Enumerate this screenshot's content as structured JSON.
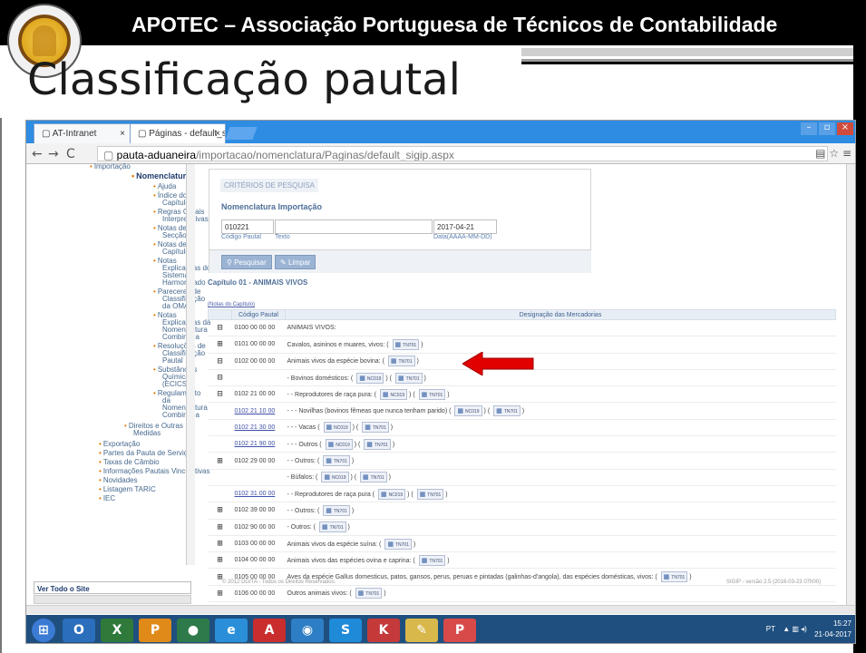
{
  "header": {
    "organization": "APOTEC – Associação Portuguesa de Técnicos de Contabilidade",
    "title": "Classificação pautal"
  },
  "browser": {
    "tabs": [
      "AT-Intranet",
      "Páginas - default_sigip"
    ],
    "url_host": "pauta-aduaneira",
    "url_path": "/importacao/nomenclatura/Paginas/default_sigip.aspx"
  },
  "sidebar": {
    "items": [
      {
        "label": "Importação",
        "bold": false
      },
      {
        "label": "Nomenclatura",
        "bold": true
      },
      {
        "label": "Ajuda",
        "bold": false
      },
      {
        "label": "Índice dos",
        "bold": false
      },
      {
        "label": "Capítulos",
        "bold": false
      },
      {
        "label": "Regras Gerais",
        "bold": false
      },
      {
        "label": "Interpretativas",
        "bold": false
      },
      {
        "label": "Notas de",
        "bold": false
      },
      {
        "label": "Secção",
        "bold": false
      },
      {
        "label": "Notas de",
        "bold": false
      },
      {
        "label": "Capítulo",
        "bold": false
      },
      {
        "label": "Notas",
        "bold": false
      },
      {
        "label": "Explicativas do",
        "bold": false
      },
      {
        "label": "Sistema",
        "bold": false
      },
      {
        "label": "Harmonizado",
        "bold": false
      },
      {
        "label": "Pareceres de",
        "bold": false
      },
      {
        "label": "Classificação",
        "bold": false
      },
      {
        "label": "da OMA",
        "bold": false
      },
      {
        "label": "Notas",
        "bold": false
      },
      {
        "label": "Explicativas da",
        "bold": false
      },
      {
        "label": "Nomenclatura",
        "bold": false
      },
      {
        "label": "Combinada",
        "bold": false
      },
      {
        "label": "Resoluções de",
        "bold": false
      },
      {
        "label": "Classificação",
        "bold": false
      },
      {
        "label": "Pautal",
        "bold": false
      },
      {
        "label": "Substâncias",
        "bold": false
      },
      {
        "label": "Químicas",
        "bold": false
      },
      {
        "label": "(ECICS)",
        "bold": false
      },
      {
        "label": "Regulamento",
        "bold": false
      },
      {
        "label": "da",
        "bold": false
      },
      {
        "label": "Nomenclatura",
        "bold": false
      },
      {
        "label": "Combinada",
        "bold": false
      },
      {
        "label": "Direitos e Outras",
        "bold": false
      },
      {
        "label": "Medidas",
        "bold": false
      },
      {
        "label": "Exportação",
        "bold": false
      },
      {
        "label": "Partes da Pauta de Serviço",
        "bold": false
      },
      {
        "label": "Taxas de Câmbio",
        "bold": false
      },
      {
        "label": "Informações Pautais Vinculativas",
        "bold": false
      },
      {
        "label": "Novidades",
        "bold": false
      },
      {
        "label": "Listagem TARIC",
        "bold": false
      },
      {
        "label": "IEC",
        "bold": false
      }
    ],
    "see_all": "Ver Todo o Site"
  },
  "search": {
    "legend": "CRITÉRIOS DE PESQUISA",
    "title": "Nomenclatura Importação",
    "code_value": "010221",
    "text_value": "",
    "date_value": "2017-04-21",
    "code_label": "Código Pautal",
    "text_label": "Texto",
    "date_label": "Data(AAAA-MM-DD)",
    "search_button": "Pesquisar",
    "clear_button": "Limpar"
  },
  "chapter": {
    "title": "Capítulo 01 - ANIMAIS VIVOS",
    "notes_link": "(Notas do Capítulo)"
  },
  "table": {
    "col_code": "Código Pautal",
    "col_desc": "Designação das Mercadorias",
    "rows": [
      {
        "sym": "⊟",
        "code": "0100 00 00 00",
        "desc": "ANIMAIS VIVOS:",
        "tags": [],
        "link": false
      },
      {
        "sym": "⊞",
        "code": "0101 00 00 00",
        "desc": "Cavalos, asininos e muares, vivos:",
        "tags": [
          "TN701"
        ],
        "link": false
      },
      {
        "sym": "⊟",
        "code": "0102 00 00 00",
        "desc": "Animais vivos da espécie bovina:",
        "tags": [
          "TN701"
        ],
        "link": false
      },
      {
        "sym": "⊟",
        "code": "",
        "desc": "- Bovinos domésticos:",
        "tags": [
          "NC019",
          "TN701"
        ],
        "link": false
      },
      {
        "sym": "⊟",
        "code": "0102 21 00 00",
        "desc": "- - Reprodutores de raça pura:",
        "tags": [
          "NC019",
          "TN701"
        ],
        "link": false
      },
      {
        "sym": "",
        "code": "0102 21 10 00",
        "desc": "- - - Novilhas (bovinos fêmeas que nunca tenham parido)",
        "tags": [
          "NC019",
          "TN701"
        ],
        "link": true
      },
      {
        "sym": "",
        "code": "0102 21 30 00",
        "desc": "- - - Vacas",
        "tags": [
          "NC019",
          "TN701"
        ],
        "link": true
      },
      {
        "sym": "",
        "code": "0102 21 90 00",
        "desc": "- - - Outros",
        "tags": [
          "NC019",
          "TN701"
        ],
        "link": true
      },
      {
        "sym": "⊞",
        "code": "0102 29 00 00",
        "desc": "- - Outros:",
        "tags": [
          "TN701"
        ],
        "link": false
      },
      {
        "sym": "",
        "code": "",
        "desc": "- Búfalos:",
        "tags": [
          "NC019",
          "TN701"
        ],
        "link": false
      },
      {
        "sym": "",
        "code": "0102 31 00 00",
        "desc": "- - Reprodutores de raça pura",
        "tags": [
          "NC019",
          "TN701"
        ],
        "link": true
      },
      {
        "sym": "⊞",
        "code": "0102 39 00 00",
        "desc": "- - Outros:",
        "tags": [
          "TN701"
        ],
        "link": false
      },
      {
        "sym": "⊞",
        "code": "0102 90 00 00",
        "desc": "- Outros:",
        "tags": [
          "TN701"
        ],
        "link": false
      },
      {
        "sym": "⊞",
        "code": "0103 00 00 00",
        "desc": "Animais vivos da espécie suína:",
        "tags": [
          "TN701"
        ],
        "link": false
      },
      {
        "sym": "⊞",
        "code": "0104 00 00 00",
        "desc": "Animais vivos das espécies ovina e caprina:",
        "tags": [
          "TN701"
        ],
        "link": false
      },
      {
        "sym": "⊞",
        "code": "0105 00 00 00",
        "desc": "Aves da espécie Gallus domesticus, patos, gansos, perus, peruas e pintadas (galinhas-d'angola), das espécies domésticas, vivos:",
        "tags": [
          "TN701"
        ],
        "link": false
      },
      {
        "sym": "⊞",
        "code": "0106 00 00 00",
        "desc": "Outros animais vivos:",
        "tags": [
          "TN701"
        ],
        "link": false
      }
    ]
  },
  "footer": {
    "left": "© 2012 DGITA - Todos os Direitos Reservados.",
    "right": "SIGIP - versão 2.5 (2016-03-23 07h00)"
  },
  "taskbar": {
    "lang": "PT",
    "time": "15:27",
    "date": "21-04-2017"
  },
  "colors": {
    "browser_blue": "#2e8ce2",
    "nav_link": "#45688e",
    "bullet_orange": "#e07a00",
    "arrow_red": "#e00000"
  }
}
